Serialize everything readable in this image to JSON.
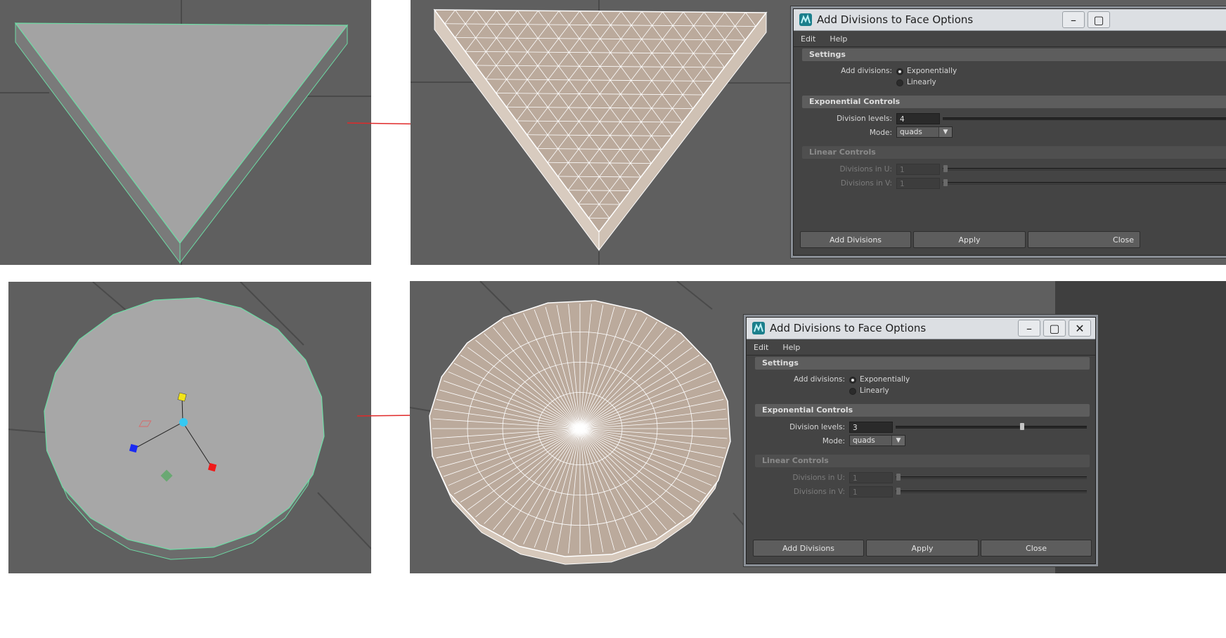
{
  "colors": {
    "viewport_bg": "#5f5f5f",
    "mesh_fill": "#bbaa9c",
    "selected_outline": "#6ddca5",
    "arrow": "#e02a2a",
    "dialog_bg": "#444444"
  },
  "dialog_top": {
    "title": "Add Divisions to Face Options",
    "menu": {
      "edit": "Edit",
      "help": "Help"
    },
    "settings_header": "Settings",
    "add_divisions_label": "Add divisions:",
    "option_exponential": "Exponentially",
    "option_linear": "Linearly",
    "exp_header": "Exponential Controls",
    "division_levels_label": "Division levels:",
    "division_levels_value": "4",
    "mode_label": "Mode:",
    "mode_value": "quads",
    "linear_header": "Linear Controls",
    "div_u_label": "Divisions in U:",
    "div_u_value": "1",
    "div_v_label": "Divisions in V:",
    "div_v_value": "1",
    "btn_add": "Add Divisions",
    "btn_apply": "Apply",
    "btn_close": "Close"
  },
  "dialog_bottom": {
    "title": "Add Divisions to Face Options",
    "menu": {
      "edit": "Edit",
      "help": "Help"
    },
    "settings_header": "Settings",
    "add_divisions_label": "Add divisions:",
    "option_exponential": "Exponentially",
    "option_linear": "Linearly",
    "exp_header": "Exponential Controls",
    "division_levels_label": "Division levels:",
    "division_levels_value": "3",
    "mode_label": "Mode:",
    "mode_value": "quads",
    "linear_header": "Linear Controls",
    "div_u_label": "Divisions in U:",
    "div_u_value": "1",
    "div_v_label": "Divisions in V:",
    "div_v_value": "1",
    "btn_add": "Add Divisions",
    "btn_apply": "Apply",
    "btn_close": "Close"
  }
}
